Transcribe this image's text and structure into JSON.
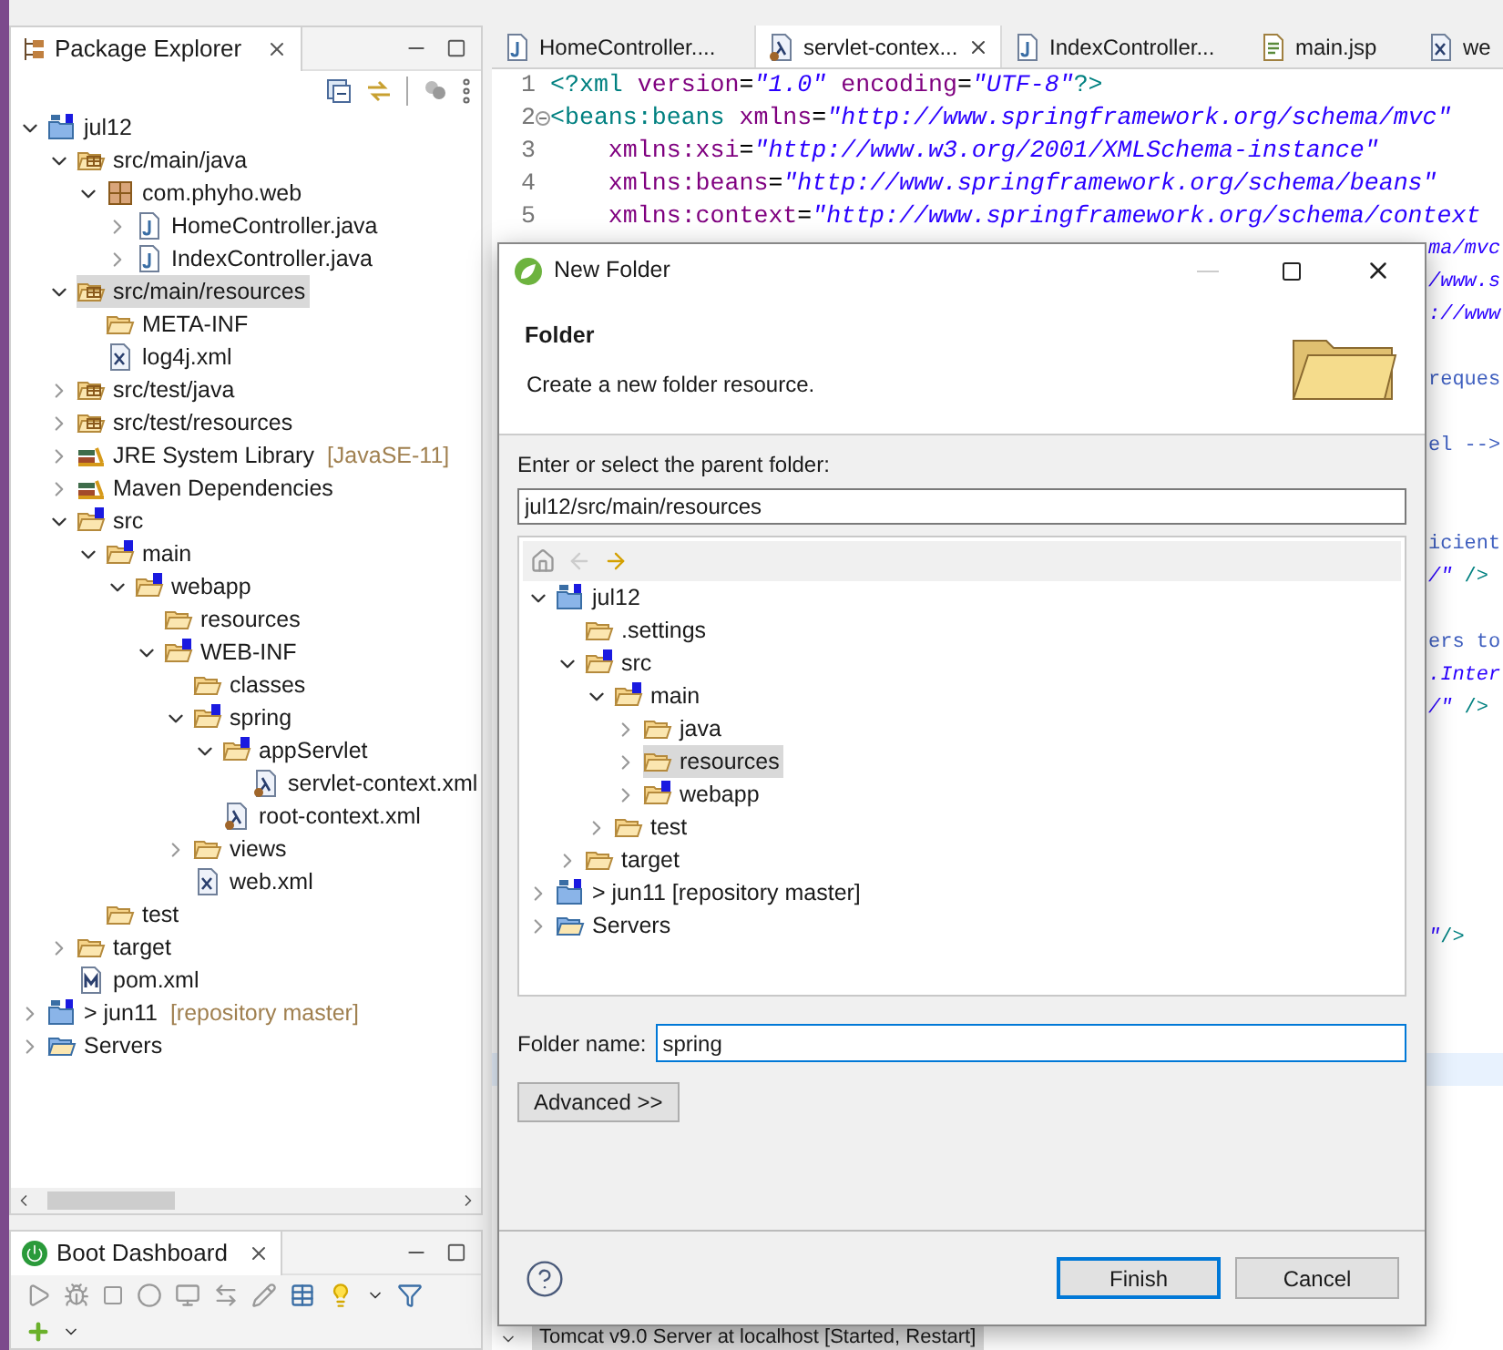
{
  "explorer": {
    "title": "Package Explorer",
    "tree": [
      {
        "label": "jul12",
        "kind": "project",
        "expanded": true,
        "selected": false,
        "children": [
          {
            "label": "src/main/java",
            "kind": "source-folder",
            "expanded": true,
            "selected": false,
            "children": [
              {
                "label": "com.phyho.web",
                "kind": "package",
                "expanded": true,
                "selected": false,
                "children": [
                  {
                    "label": "HomeController.java",
                    "kind": "java",
                    "expanded": false,
                    "selected": false
                  },
                  {
                    "label": "IndexController.java",
                    "kind": "java",
                    "expanded": false,
                    "selected": false
                  }
                ]
              }
            ]
          },
          {
            "label": "src/main/resources",
            "kind": "source-folder",
            "expanded": true,
            "selected": true,
            "children": [
              {
                "label": "META-INF",
                "kind": "folder",
                "selected": false
              },
              {
                "label": "log4j.xml",
                "kind": "xml",
                "selected": false
              }
            ]
          },
          {
            "label": "src/test/java",
            "kind": "source-folder",
            "expanded": false,
            "selected": false
          },
          {
            "label": "src/test/resources",
            "kind": "source-folder",
            "expanded": false,
            "selected": false
          },
          {
            "label": "JRE System Library",
            "decoration": "[JavaSE-11]",
            "kind": "library",
            "expanded": false,
            "selected": false
          },
          {
            "label": "Maven Dependencies",
            "kind": "library",
            "expanded": false,
            "selected": false
          },
          {
            "label": "src",
            "kind": "spring-folder",
            "expanded": true,
            "selected": false,
            "children": [
              {
                "label": "main",
                "kind": "spring-folder",
                "expanded": true,
                "selected": false,
                "children": [
                  {
                    "label": "webapp",
                    "kind": "spring-folder",
                    "expanded": true,
                    "selected": false,
                    "children": [
                      {
                        "label": "resources",
                        "kind": "folder",
                        "selected": false
                      },
                      {
                        "label": "WEB-INF",
                        "kind": "spring-folder",
                        "expanded": true,
                        "selected": false,
                        "children": [
                          {
                            "label": "classes",
                            "kind": "folder",
                            "selected": false
                          },
                          {
                            "label": "spring",
                            "kind": "spring-folder",
                            "expanded": true,
                            "selected": false,
                            "children": [
                              {
                                "label": "appServlet",
                                "kind": "spring-folder",
                                "expanded": true,
                                "selected": false,
                                "children": [
                                  {
                                    "label": "servlet-context.xml",
                                    "kind": "bean-xml",
                                    "selected": false
                                  }
                                ]
                              },
                              {
                                "label": "root-context.xml",
                                "kind": "bean-xml",
                                "selected": false
                              }
                            ]
                          },
                          {
                            "label": "views",
                            "kind": "folder",
                            "expanded": false,
                            "selected": false
                          },
                          {
                            "label": "web.xml",
                            "kind": "xml",
                            "selected": false
                          }
                        ]
                      }
                    ]
                  }
                ]
              },
              {
                "label": "test",
                "kind": "folder",
                "selected": false
              }
            ]
          },
          {
            "label": "target",
            "kind": "folder",
            "expanded": false,
            "selected": false
          },
          {
            "label": "pom.xml",
            "kind": "pom",
            "selected": false
          }
        ]
      },
      {
        "label": "> jun11",
        "decoration": "[repository master]",
        "kind": "project",
        "expanded": false,
        "selected": false
      },
      {
        "label": "Servers",
        "kind": "servers",
        "expanded": false,
        "selected": false
      }
    ]
  },
  "boot_dashboard": {
    "title": "Boot Dashboard"
  },
  "editor": {
    "tabs": [
      {
        "label": "HomeController....",
        "kind": "java",
        "selected": false
      },
      {
        "label": "servlet-contex...",
        "kind": "bean-xml",
        "selected": true
      },
      {
        "label": "IndexController...",
        "kind": "java",
        "selected": false
      },
      {
        "label": "main.jsp",
        "kind": "jsp",
        "selected": false
      },
      {
        "label": "we",
        "kind": "xml",
        "selected": false
      }
    ],
    "lines": [
      {
        "number": "1",
        "foldable": false,
        "tokens": [
          {
            "text": "<?xml",
            "kind": "tag"
          },
          {
            "text": " version",
            "kind": "attr"
          },
          {
            "text": "=",
            "kind": "punct"
          },
          {
            "text": "\"1.0\"",
            "kind": "value"
          },
          {
            "text": " encoding",
            "kind": "attr"
          },
          {
            "text": "=",
            "kind": "punct"
          },
          {
            "text": "\"UTF-8\"",
            "kind": "value"
          },
          {
            "text": "?>",
            "kind": "tag"
          }
        ]
      },
      {
        "number": "2",
        "foldable": true,
        "tokens": [
          {
            "text": "<beans:beans",
            "kind": "tag"
          },
          {
            "text": " xmlns",
            "kind": "attr"
          },
          {
            "text": "=",
            "kind": "punct"
          },
          {
            "text": "\"http://www.springframework.org/schema/mvc\"",
            "kind": "value"
          }
        ]
      },
      {
        "number": "3",
        "foldable": false,
        "tokens": [
          {
            "text": "    xmlns:xsi",
            "kind": "attr"
          },
          {
            "text": "=",
            "kind": "punct"
          },
          {
            "text": "\"http://www.w3.org/2001/XMLSchema-instance\"",
            "kind": "value"
          }
        ]
      },
      {
        "number": "4",
        "foldable": false,
        "tokens": [
          {
            "text": "    xmlns:beans",
            "kind": "attr"
          },
          {
            "text": "=",
            "kind": "punct"
          },
          {
            "text": "\"http://www.springframework.org/schema/beans\"",
            "kind": "value"
          }
        ]
      },
      {
        "number": "5",
        "foldable": false,
        "tokens": [
          {
            "text": "    xmlns:context",
            "kind": "attr"
          },
          {
            "text": "=",
            "kind": "punct"
          },
          {
            "text": "\"http://www.springframework.org/schema/context",
            "kind": "value"
          }
        ]
      }
    ],
    "fragments": [
      {
        "tokens": [
          {
            "text": "ma/mvc",
            "kind": "value"
          }
        ]
      },
      {
        "tokens": [
          {
            "text": "/www.s",
            "kind": "value"
          }
        ]
      },
      {
        "tokens": [
          {
            "text": "://www",
            "kind": "value"
          }
        ]
      },
      {
        "tokens": [
          {
            "text": "reques",
            "kind": "comment"
          }
        ]
      },
      {
        "tokens": [
          {
            "text": "el -->",
            "kind": "comment"
          }
        ]
      },
      {
        "tokens": [
          {
            "text": "icient",
            "kind": "comment"
          }
        ]
      },
      {
        "tokens": [
          {
            "text": "/\"",
            "kind": "value"
          },
          {
            "text": " />",
            "kind": "tag"
          }
        ]
      },
      {
        "tokens": [
          {
            "text": "ers to",
            "kind": "comment"
          }
        ]
      },
      {
        "tokens": [
          {
            "text": ".Inter",
            "kind": "value"
          }
        ]
      },
      {
        "tokens": [
          {
            "text": "/\"",
            "kind": "value"
          },
          {
            "text": " />",
            "kind": "tag"
          }
        ]
      },
      {
        "tokens": [
          {
            "text": "\"",
            "kind": "value"
          },
          {
            "text": "/>",
            "kind": "tag"
          }
        ]
      }
    ]
  },
  "servers_view": {
    "row": "Tomcat v9.0 Server at localhost  [Started, Restart]"
  },
  "dialog": {
    "title": "New Folder",
    "heading": "Folder",
    "description": "Create a new folder resource.",
    "parent_label": "Enter or select the parent folder:",
    "parent_value": "jul12/src/main/resources",
    "tree": [
      {
        "label": "jul12",
        "kind": "project",
        "expanded": true,
        "selected": false,
        "children": [
          {
            "label": ".settings",
            "kind": "folder",
            "selected": false
          },
          {
            "label": "src",
            "kind": "spring-folder",
            "expanded": true,
            "selected": false,
            "children": [
              {
                "label": "main",
                "kind": "spring-folder",
                "expanded": true,
                "selected": false,
                "children": [
                  {
                    "label": "java",
                    "kind": "folder",
                    "expanded": false,
                    "selected": false
                  },
                  {
                    "label": "resources",
                    "kind": "folder",
                    "expanded": false,
                    "selected": true
                  },
                  {
                    "label": "webapp",
                    "kind": "spring-folder",
                    "expanded": false,
                    "selected": false
                  }
                ]
              },
              {
                "label": "test",
                "kind": "folder",
                "expanded": false,
                "selected": false
              }
            ]
          },
          {
            "label": "target",
            "kind": "folder",
            "expanded": false,
            "selected": false
          }
        ]
      },
      {
        "label": "> jun11 [repository master]",
        "kind": "project",
        "expanded": false,
        "selected": false
      },
      {
        "label": "Servers",
        "kind": "servers",
        "expanded": false,
        "selected": false
      }
    ],
    "name_label": "Folder name:",
    "name_value": "spring",
    "advanced_button": "Advanced >>",
    "buttons": [
      {
        "label": "Finish",
        "default": true
      },
      {
        "label": "Cancel",
        "default": false
      }
    ]
  }
}
